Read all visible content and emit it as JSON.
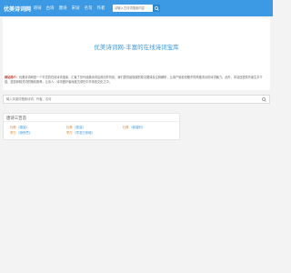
{
  "header": {
    "logo": "优美诗词网",
    "nav": [
      "诗词",
      "古诗",
      "唐诗",
      "宋词",
      "名句",
      "作者"
    ],
    "search_placeholder": "请输入古诗词搜索内容"
  },
  "hero": {
    "title": "优美诗词网-丰富的在线诗词宝库"
  },
  "intro": {
    "label": "网站简介：",
    "text": "优美诗词网是一个丰富的在线诗词宝库，汇聚了历代经典诗词及其创作背景。我们提供最权威的原文翻译及注释解析，让用户轻松领略不同风格流派的诗词魅力。此外，本站还提供作者生平介绍、鉴赏和相关词的随机推荐，让诗人、诗词爱好者深度沉浸在中华传统文化之中。"
  },
  "search": {
    "placeholder": "输入关键词搜索诗词、作者、名句"
  },
  "panel": {
    "title": "唐诗三百首",
    "poems": [
      {
        "author": "杜甫",
        "title": "《春望》"
      },
      {
        "author": "杜甫",
        "title": "《登高》"
      },
      {
        "author": "杜甫",
        "title": "《新婚别》"
      },
      {
        "author": "李白",
        "title": "《静夜思》"
      },
      {
        "author": "李白",
        "title": "《早发白帝城》"
      }
    ]
  }
}
